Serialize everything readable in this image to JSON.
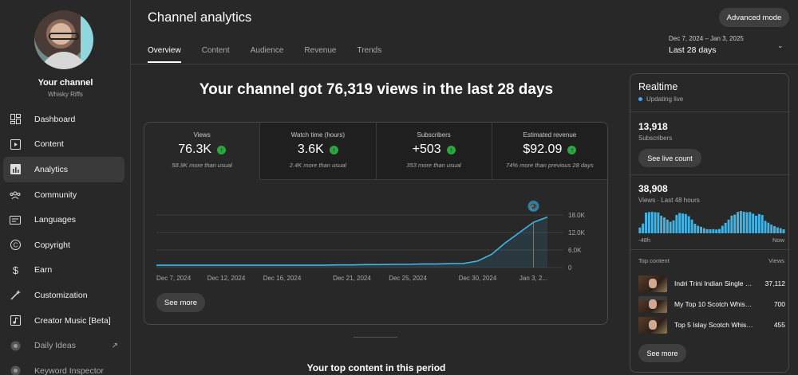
{
  "channel": {
    "name": "Your channel",
    "handle": "Whisky Riffs"
  },
  "sidebar": {
    "items": [
      {
        "label": "Dashboard",
        "icon": "dashboard-icon"
      },
      {
        "label": "Content",
        "icon": "content-icon"
      },
      {
        "label": "Analytics",
        "icon": "analytics-icon",
        "active": true
      },
      {
        "label": "Community",
        "icon": "community-icon"
      },
      {
        "label": "Languages",
        "icon": "languages-icon"
      },
      {
        "label": "Copyright",
        "icon": "copyright-icon"
      },
      {
        "label": "Earn",
        "icon": "earn-icon"
      },
      {
        "label": "Customization",
        "icon": "customization-icon"
      },
      {
        "label": "Creator Music [Beta]",
        "icon": "creator-music-icon"
      },
      {
        "label": "Daily Ideas",
        "icon": "daily-ideas-icon"
      },
      {
        "label": "Keyword Inspector",
        "icon": "keyword-inspector-icon"
      }
    ]
  },
  "header": {
    "title": "Channel analytics",
    "advanced_mode": "Advanced mode",
    "tabs": [
      "Overview",
      "Content",
      "Audience",
      "Revenue",
      "Trends"
    ],
    "date_range": "Dec 7, 2024 – Jan 3, 2025",
    "date_label": "Last 28 days"
  },
  "main": {
    "headline": "Your channel got 76,319 views in the last 28 days",
    "metrics": [
      {
        "label": "Views",
        "value": "76.3K",
        "note": "58.9K more than usual"
      },
      {
        "label": "Watch time (hours)",
        "value": "3.6K",
        "note": "2.4K more than usual"
      },
      {
        "label": "Subscribers",
        "value": "+503",
        "note": "353 more than usual"
      },
      {
        "label": "Estimated revenue",
        "value": "$92.09",
        "note": "74% more than previous 28 days"
      }
    ],
    "see_more": "See more",
    "top_content_title": "Your top content in this period"
  },
  "chart_data": {
    "type": "area",
    "x": [
      "Dec 7, 2024",
      "Dec 8",
      "Dec 9",
      "Dec 10",
      "Dec 11",
      "Dec 12, 2024",
      "Dec 13",
      "Dec 14",
      "Dec 15",
      "Dec 16, 2024",
      "Dec 17",
      "Dec 18",
      "Dec 19",
      "Dec 20",
      "Dec 21, 2024",
      "Dec 22",
      "Dec 23",
      "Dec 24",
      "Dec 25, 2024",
      "Dec 26",
      "Dec 27",
      "Dec 28",
      "Dec 29",
      "Dec 30, 2024",
      "Dec 31",
      "Jan 1",
      "Jan 2",
      "Jan 3, 2025"
    ],
    "y": [
      800,
      800,
      800,
      800,
      800,
      800,
      800,
      800,
      800,
      800,
      800,
      800,
      800,
      900,
      900,
      1000,
      1000,
      1100,
      1100,
      1200,
      1200,
      1300,
      1400,
      2200,
      4500,
      8500,
      12000,
      15500,
      17300
    ],
    "x_tick_labels": [
      "Dec 7, 2024",
      "Dec 12, 2024",
      "Dec 16, 2024",
      "Dec 21, 2024",
      "Dec 25, 2024",
      "Dec 30, 2024",
      "Jan 3, 2..."
    ],
    "y_tick_labels": [
      "18.0K",
      "12.0K",
      "6.0K",
      "0"
    ],
    "ylim": [
      0,
      18000
    ],
    "grid": true,
    "color": "#41b4e6"
  },
  "realtime": {
    "title": "Realtime",
    "status": "Updating live",
    "subscribers": "13,918",
    "subscribers_label": "Subscribers",
    "live_count_button": "See live count",
    "views": "38,908",
    "views_label": "Views · Last 48 hours",
    "bar_start": "-48h",
    "bar_end": "Now",
    "hourly_views": [
      320,
      540,
      1150,
      1180,
      1190,
      1170,
      1160,
      980,
      880,
      760,
      640,
      720,
      1020,
      1130,
      1100,
      1070,
      950,
      760,
      530,
      420,
      360,
      280,
      230,
      220,
      230,
      210,
      240,
      420,
      580,
      760,
      980,
      1040,
      1190,
      1240,
      1200,
      1170,
      1180,
      1090,
      980,
      1070,
      1020,
      690,
      590,
      480,
      400,
      330,
      280,
      220
    ],
    "top_content_label": "Top content",
    "views_col": "Views",
    "top_content": [
      {
        "title": "Indri Trini Indian Single Malt Whisky",
        "views": "37,112"
      },
      {
        "title": "My Top 10 Scotch Whiskies",
        "views": "700"
      },
      {
        "title": "Top 5 Islay Scotch Whiskies",
        "views": "455"
      }
    ],
    "see_more": "See more"
  }
}
